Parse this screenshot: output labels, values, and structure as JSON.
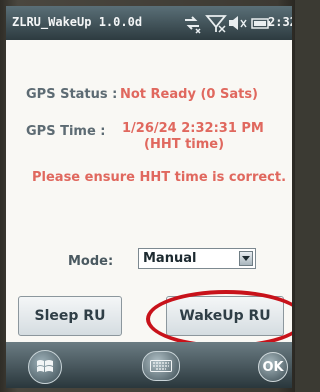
{
  "statusbar": {
    "app_title": "ZLRU_WakeUp 1.0.0d",
    "clock": "2:32",
    "icons": [
      "sync-icon",
      "no-signal-icon",
      "volume-icon",
      "battery-icon"
    ]
  },
  "gps": {
    "status_label": "GPS Status :",
    "status_value": "Not Ready (0 Sats)",
    "time_label": "GPS Time :",
    "time_value": "1/26/24 2:32:31 PM",
    "time_note": "(HHT time)",
    "message": "Please ensure HHT time is correct."
  },
  "mode": {
    "label": "Mode:",
    "selected": "Manual"
  },
  "buttons": {
    "sleep_label": "Sleep RU",
    "wakeup_label": "WakeUp RU"
  },
  "taskbar": {
    "ok_label": "OK",
    "icons": [
      "windows-start-icon",
      "keyboard-icon"
    ]
  },
  "colors": {
    "value_text": "#e0685e",
    "label_text": "#5d6b73",
    "highlight": "#c8121a"
  }
}
